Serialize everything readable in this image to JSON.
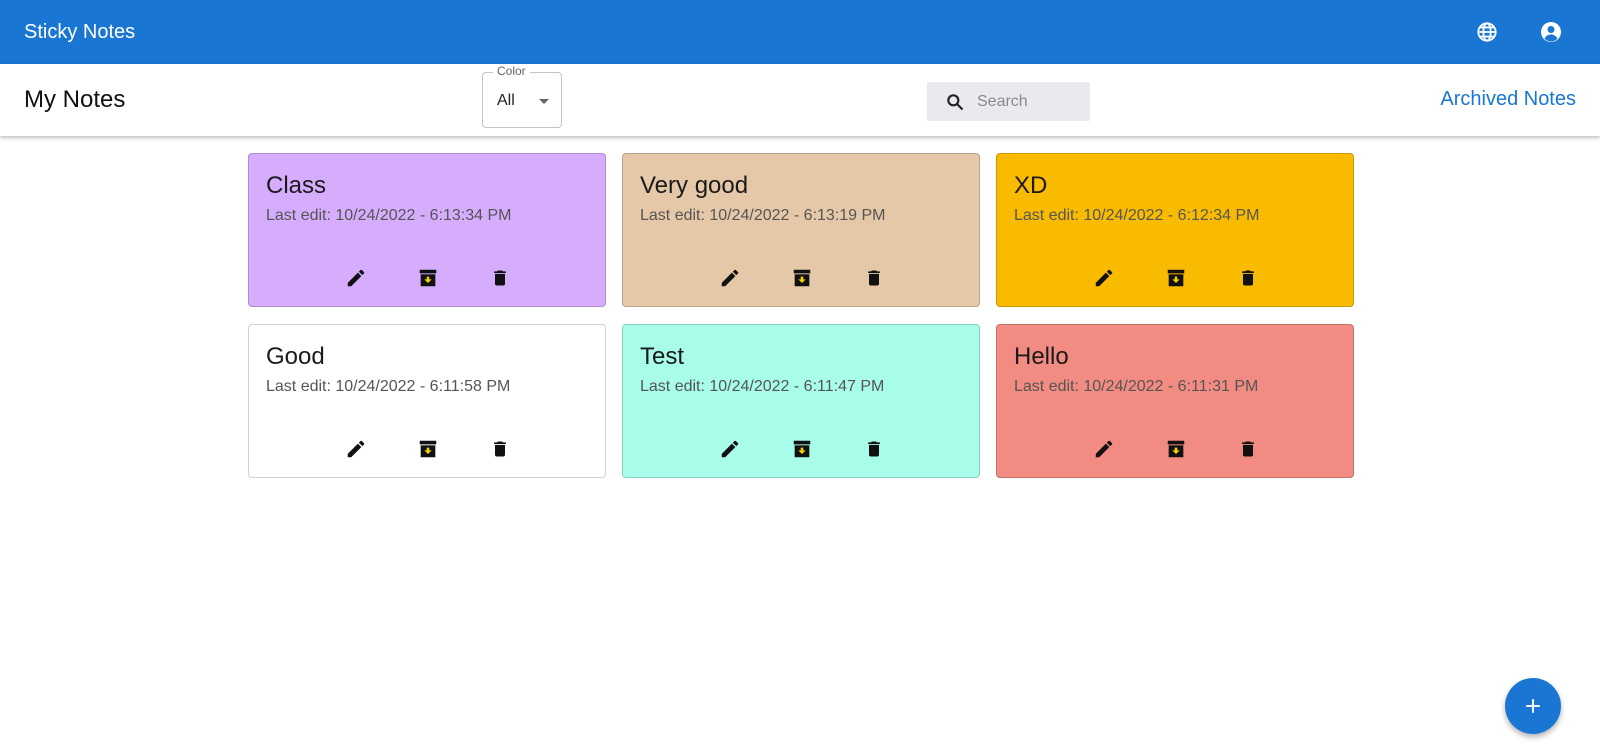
{
  "app": {
    "title": "Sticky Notes"
  },
  "header_icons": {
    "language": "globe-icon",
    "account": "account-circle-icon"
  },
  "toolbar": {
    "page_title": "My Notes",
    "color_filter": {
      "label": "Color",
      "value": "All"
    },
    "search": {
      "placeholder": "Search",
      "value": ""
    },
    "archived_link": "Archived Notes"
  },
  "notes": [
    {
      "title": "Class",
      "last_edit": "Last edit: 10/24/2022 - 6:13:34 PM",
      "color": "#d6adfc"
    },
    {
      "title": "Very good",
      "last_edit": "Last edit: 10/24/2022 - 6:13:19 PM",
      "color": "#e5c8a8"
    },
    {
      "title": "XD",
      "last_edit": "Last edit: 10/24/2022 - 6:12:34 PM",
      "color": "#f9bb00"
    },
    {
      "title": "Good",
      "last_edit": "Last edit: 10/24/2022 - 6:11:58 PM",
      "color": "#ffffff"
    },
    {
      "title": "Test",
      "last_edit": "Last edit: 10/24/2022 - 6:11:47 PM",
      "color": "#a7fdea"
    },
    {
      "title": "Hello",
      "last_edit": "Last edit: 10/24/2022 - 6:11:31 PM",
      "color": "#f28b82"
    }
  ],
  "note_actions": [
    "edit-icon",
    "archive-icon",
    "delete-icon"
  ],
  "fab": {
    "icon": "add-icon"
  },
  "colors": {
    "primary": "#1976d2",
    "search_bg": "#e9eaed"
  }
}
